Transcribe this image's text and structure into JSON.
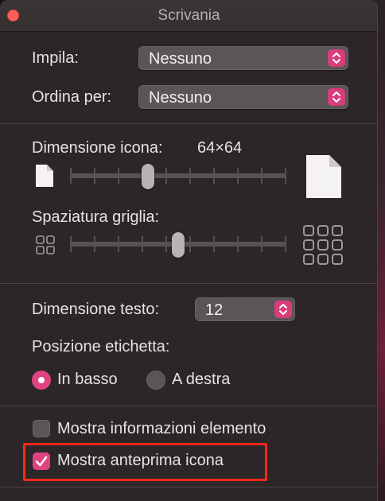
{
  "window": {
    "title": "Scrivania"
  },
  "stack_row": {
    "label": "Impila:",
    "value": "Nessuno"
  },
  "sort_row": {
    "label": "Ordina per:",
    "value": "Nessuno"
  },
  "icon_size": {
    "label": "Dimensione icona:",
    "value": "64×64",
    "level": 0.35
  },
  "grid_spacing": {
    "label": "Spaziatura griglia:",
    "level": 0.5
  },
  "text_size": {
    "label": "Dimensione testo:",
    "value": "12"
  },
  "label_position": {
    "label": "Posizione etichetta:",
    "options": [
      {
        "label": "In basso",
        "selected": true
      },
      {
        "label": "A destra",
        "selected": false
      }
    ]
  },
  "checkboxes": [
    {
      "label": "Mostra informazioni elemento",
      "checked": false
    },
    {
      "label": "Mostra anteprima icona",
      "checked": true
    }
  ],
  "colors": {
    "accent": "#e0437f",
    "highlight": "#ff2a1c",
    "close": "#ff5f57"
  }
}
